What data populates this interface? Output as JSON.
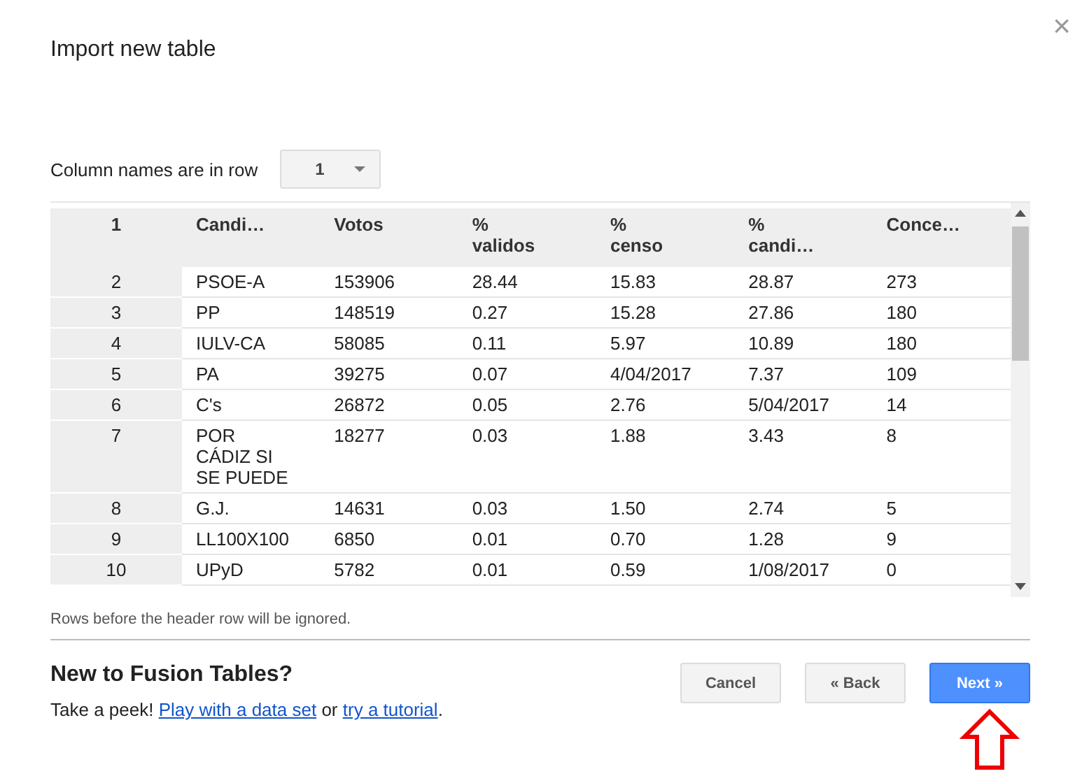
{
  "dialog": {
    "title": "Import new table",
    "close": "×"
  },
  "header_row": {
    "label": "Column names are in row",
    "value": "1"
  },
  "table": {
    "row_header": "1",
    "columns": [
      "Candi…",
      "Votos",
      "%\nvalidos",
      "%\ncenso",
      "%\ncandi…",
      "Conce…"
    ],
    "rows": [
      {
        "number": "2",
        "cells": [
          "PSOE-A",
          "153906",
          "28.44",
          "15.83",
          "28.87",
          "273"
        ]
      },
      {
        "number": "3",
        "cells": [
          "PP",
          "148519",
          "0.27",
          "15.28",
          "27.86",
          "180"
        ]
      },
      {
        "number": "4",
        "cells": [
          "IULV-CA",
          "58085",
          "0.11",
          "5.97",
          "10.89",
          "180"
        ]
      },
      {
        "number": "5",
        "cells": [
          "PA",
          "39275",
          "0.07",
          "4/04/2017",
          "7.37",
          "109"
        ]
      },
      {
        "number": "6",
        "cells": [
          "C's",
          "26872",
          "0.05",
          "2.76",
          "5/04/2017",
          "14"
        ]
      },
      {
        "number": "7",
        "cells": [
          "POR\nCÁDIZ SI\nSE PUEDE",
          "18277",
          "0.03",
          "1.88",
          "3.43",
          "8"
        ]
      },
      {
        "number": "8",
        "cells": [
          "G.J.",
          "14631",
          "0.03",
          "1.50",
          "2.74",
          "5"
        ]
      },
      {
        "number": "9",
        "cells": [
          "LL100X100",
          "6850",
          "0.01",
          "0.70",
          "1.28",
          "9"
        ]
      },
      {
        "number": "10",
        "cells": [
          "UPyD",
          "5782",
          "0.01",
          "0.59",
          "1/08/2017",
          "0"
        ]
      }
    ]
  },
  "note": "Rows before the header row will be ignored.",
  "footer": {
    "heading": "New to Fusion Tables?",
    "text_before": "Take a peek!",
    "link_1": "Play with a data set",
    "text_middle": "or",
    "link_2": "try a tutorial",
    "text_after": "."
  },
  "buttons": [
    {
      "label": "Cancel",
      "kind": "plain"
    },
    {
      "label": "« Back",
      "kind": "plain"
    },
    {
      "label": "Next »",
      "kind": "primary"
    }
  ]
}
